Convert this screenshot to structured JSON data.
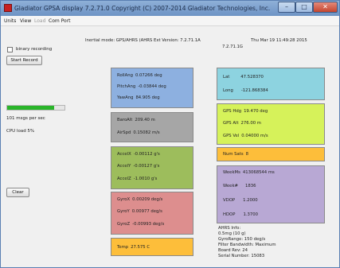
{
  "window": {
    "title": "Gladiator GPSA display  7.2.71.0 Copyright (C) 2007-2014 Gladiator Technologies, Inc.",
    "close_glyph": "✕",
    "min_glyph": "–",
    "max_glyph": "□"
  },
  "menu": {
    "units": "Units",
    "view": "View",
    "load": "Load",
    "com_port": "Com Port"
  },
  "left": {
    "binary_label": "binary recording",
    "start_record": "Start Record",
    "rate_fill_fraction": 0.82,
    "msgs_per_sec": "101  msgs per sec",
    "cpu_load": "CPU load  5%",
    "clear": "Clear"
  },
  "header": {
    "inertial_mode": "Inertial mode: GPS/AHRS  (AHRS Ext Version: 7.2.71.1A",
    "version_line2": "7.2.71.1G",
    "datetime": "Thu Mar 19 11:49:28 2015"
  },
  "orientation": [
    {
      "label": "RollAng",
      "value": "0.07266  deg"
    },
    {
      "label": "PitchAng",
      "value": "-0.03844  deg"
    },
    {
      "label": "YawAng",
      "value": "84.905  deg"
    }
  ],
  "air": [
    {
      "label": "BaroAlt",
      "value": "209.40  m"
    },
    {
      "label": "AirSpd",
      "value": "0.15082  m/s"
    }
  ],
  "accel": [
    {
      "label": "AccelX",
      "value": "-0.00112  g's"
    },
    {
      "label": "AccelY",
      "value": "-0.00127  g's"
    },
    {
      "label": "AccelZ",
      "value": "-1.0010  g's"
    }
  ],
  "gyro": [
    {
      "label": "GyroX",
      "value": "0.00209  deg/s"
    },
    {
      "label": "GyroY",
      "value": "0.00977  deg/s"
    },
    {
      "label": "GyroZ",
      "value": "-0.00993  deg/s"
    }
  ],
  "temp": {
    "label": "Temp",
    "value": "27.575  C"
  },
  "position": [
    {
      "label": "Lat",
      "value": "47.528370"
    },
    {
      "label": "Long",
      "value": "-121.868384"
    }
  ],
  "gps": [
    {
      "label": "GPS Hdg",
      "value": "19.470  deg"
    },
    {
      "label": "GPS Alt",
      "value": "276.00  m"
    },
    {
      "label": "GPS Vel",
      "value": "0.04000  m/s"
    }
  ],
  "sats": {
    "label": "Num Sats",
    "value": "8"
  },
  "timing": [
    {
      "label": "WeekMs",
      "value": "413068544  ms"
    },
    {
      "label": "Week#",
      "value": "1836"
    },
    {
      "label": "VDOP",
      "value": "1.2000"
    },
    {
      "label": "HDOP",
      "value": "1.3700"
    }
  ],
  "ahrs_info": {
    "title": "AHRS Info:",
    "line1": "0.5mg (10 g)",
    "line2": "GyroRange:  150 deg/s",
    "line3": "Filter Bandwidth: Maximum",
    "line4": "Board Rev: 24",
    "line5": "Serial Number: 15083"
  },
  "colors": {
    "orientation": "#8db0e0",
    "air": "#a6a6a6",
    "accel": "#9dbd5c",
    "gyro": "#dd8e8e",
    "temp": "#fdbe3a",
    "position": "#8dd3e0",
    "gps": "#d6f25a",
    "sats": "#fdbe3a",
    "timing": "#b8a8d4",
    "rate_bar": "#2ab52a"
  }
}
